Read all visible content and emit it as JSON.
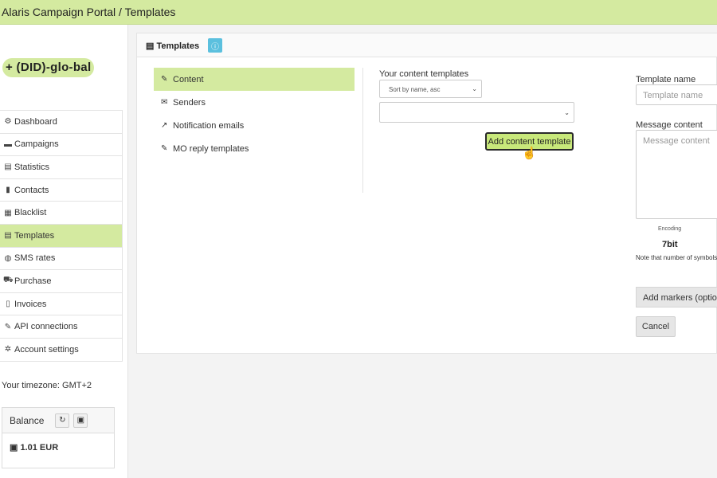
{
  "app": {
    "title": "Alaris Campaign Portal / Templates"
  },
  "brand": {
    "logo_text": "+ (DID)-glo-bal"
  },
  "sidebar": {
    "items": [
      {
        "label": "Dashboard",
        "icon": "dashboard-icon",
        "glyph": "⚙"
      },
      {
        "label": "Campaigns",
        "icon": "campaigns-icon",
        "glyph": "▬"
      },
      {
        "label": "Statistics",
        "icon": "statistics-icon",
        "glyph": "▤"
      },
      {
        "label": "Contacts",
        "icon": "contacts-icon",
        "glyph": "▮"
      },
      {
        "label": "Blacklist",
        "icon": "blacklist-icon",
        "glyph": "▦"
      },
      {
        "label": "Templates",
        "icon": "templates-icon",
        "glyph": "▤"
      },
      {
        "label": "SMS rates",
        "icon": "sms-rates-icon",
        "glyph": "◍"
      },
      {
        "label": "Purchase",
        "icon": "cart-icon",
        "glyph": "⛟"
      },
      {
        "label": "Invoices",
        "icon": "invoice-icon",
        "glyph": "▯"
      },
      {
        "label": "API connections",
        "icon": "plug-icon",
        "glyph": "✎"
      },
      {
        "label": "Account settings",
        "icon": "gear-icon",
        "glyph": "✲"
      }
    ],
    "active": "Templates",
    "timezone": "Your timezone: GMT+2",
    "balance": {
      "label": "Balance",
      "amount": "1.01 EUR"
    }
  },
  "panel": {
    "title": "Templates",
    "submenu": [
      {
        "label": "Content",
        "icon": "edit-icon",
        "glyph": "✎"
      },
      {
        "label": "Senders",
        "icon": "envelope-icon",
        "glyph": "✉"
      },
      {
        "label": "Notification emails",
        "icon": "external-link-icon",
        "glyph": "↗"
      },
      {
        "label": "MO reply templates",
        "icon": "edit-icon",
        "glyph": "✎"
      }
    ],
    "active_submenu": "Content",
    "content_templates": {
      "label": "Your content templates",
      "sort_value": "Sort by name, asc",
      "template_value": "",
      "add_button": "Add content template"
    },
    "form": {
      "template_name_label": "Template name",
      "template_name_placeholder": "Template name",
      "message_content_label": "Message content",
      "message_content_placeholder": "Message content",
      "encoding_label": "Encoding",
      "encoding_value": "7bit",
      "note": "Note that number of symbols used.",
      "markers_button": "Add markers (optional)",
      "cancel_button": "Cancel"
    }
  },
  "colors": {
    "accent": "#d4eaa0",
    "button_green": "#c8e87a",
    "info": "#5bc0de"
  }
}
